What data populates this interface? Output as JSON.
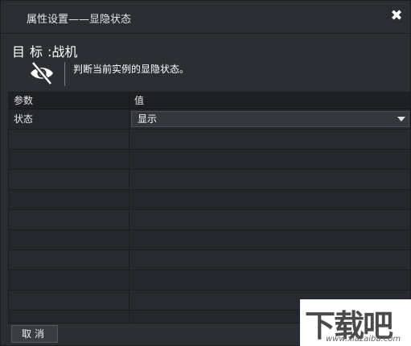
{
  "dialog": {
    "title": "属性设置——显隐状态",
    "close_symbol": "✖"
  },
  "target": {
    "label": "目标",
    "separator": ":",
    "value": "战机"
  },
  "description": {
    "icon": "eye-hidden-icon",
    "text": "判断当前实例的显隐状态。"
  },
  "grid": {
    "headers": [
      "参数",
      "值"
    ],
    "rows": [
      {
        "param": "状态",
        "value": "显示"
      }
    ]
  },
  "footer": {
    "cancel_label": "取消"
  },
  "watermark": {
    "logo_text": "下载吧",
    "url": "www.xiazaiba.com"
  },
  "colors": {
    "background": "#2b2e32",
    "header": "#1e2023",
    "text": "#e6e6e6"
  }
}
